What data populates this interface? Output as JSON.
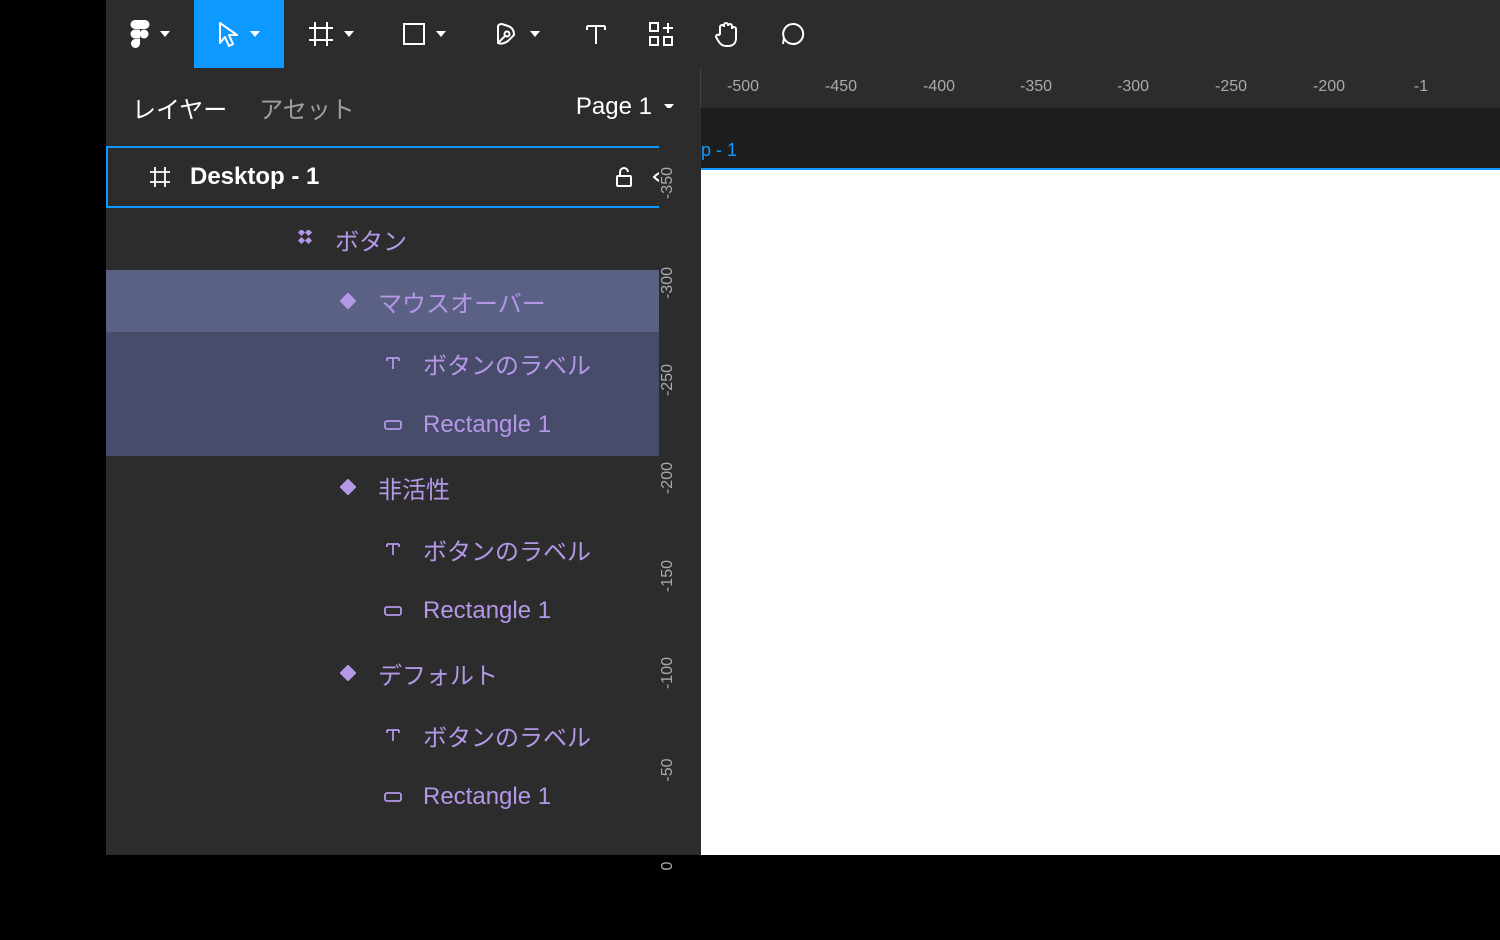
{
  "toolbar": {
    "figma_menu": "figma-menu",
    "move_tool": "move",
    "frame_tool": "frame",
    "shape_tool": "rectangle",
    "pen_tool": "pen",
    "text_tool": "text",
    "resources_tool": "resources",
    "hand_tool": "hand",
    "comment_tool": "comment"
  },
  "tabs": {
    "layers": "レイヤー",
    "assets": "アセット",
    "page_label": "Page 1"
  },
  "layers": {
    "frame": "Desktop - 1",
    "componentSet": "ボタン",
    "variant1": "マウスオーバー",
    "variant1_text": "ボタンのラベル",
    "variant1_rect": "Rectangle 1",
    "variant2": "非活性",
    "variant2_text": "ボタンのラベル",
    "variant2_rect": "Rectangle 1",
    "variant3": "デフォルト",
    "variant3_text": "ボタンのラベル",
    "variant3_rect": "Rectangle 1"
  },
  "canvas": {
    "frame_tab_label": "p - 1",
    "ruler_h": [
      "-500",
      "-450",
      "-400",
      "-350",
      "-300",
      "-250",
      "-200",
      "-1"
    ],
    "ruler_v": [
      "-350",
      "-300",
      "-250",
      "-200",
      "-150",
      "-100",
      "-50",
      "0"
    ]
  }
}
